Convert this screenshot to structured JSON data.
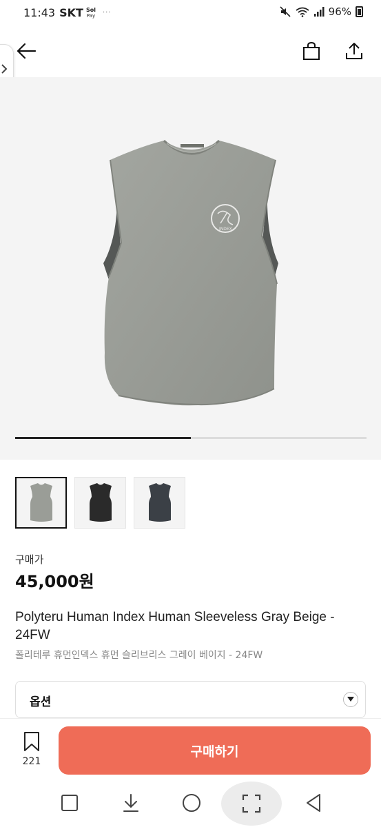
{
  "status_bar": {
    "time": "11:43",
    "carrier": "SKT",
    "sol_top": "Sol",
    "sol_bottom": "Pay",
    "dots": "···",
    "battery": "96%"
  },
  "icons": {
    "back": "arrow-left-icon",
    "bag": "shopping-bag-icon",
    "share": "share-icon",
    "side_tab": "chevron-right-icon",
    "bookmark": "bookmark-icon",
    "option": "caret-down-icon"
  },
  "gallery": {
    "progress": 0.5,
    "thumbnails": [
      "gray",
      "black",
      "charcoal"
    ]
  },
  "product": {
    "price_label": "구매가",
    "price": "45,000원",
    "title_en": "Polyteru Human Index Human Sleeveless Gray Beige - 24FW",
    "title_ko": "폴리테루 휴먼인덱스 휴먼 슬리브리스 그레이 베이지 - 24FW"
  },
  "option": {
    "label": "옵션"
  },
  "action_bar": {
    "bookmark_count": "221",
    "buy_label": "구매하기"
  },
  "colors": {
    "accent": "#ef6c57",
    "shirt_gray": "#9a9d97"
  }
}
